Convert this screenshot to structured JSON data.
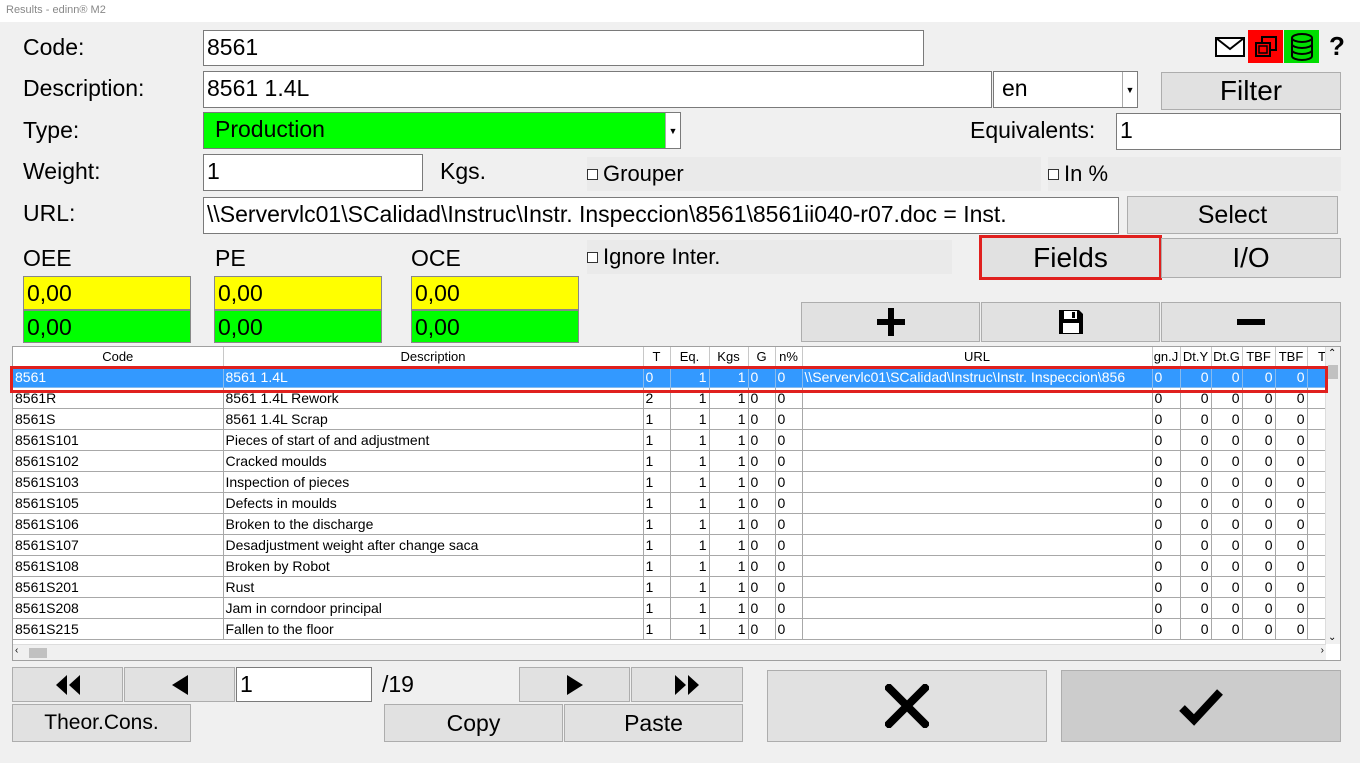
{
  "window": {
    "title": "Results - edinn® M2"
  },
  "form": {
    "code_label": "Code:",
    "code_value": "8561",
    "description_label": "Description:",
    "description_value": "8561 1.4L",
    "language_value": "en",
    "type_label": "Type:",
    "type_value": "Production",
    "weight_label": "Weight:",
    "weight_value": "1",
    "weight_unit": "Kgs.",
    "url_label": "URL:",
    "url_value": "\\\\Servervlc01\\SCalidad\\Instruc\\Instr. Inspeccion\\8561\\8561ii040-r07.doc = Inst.",
    "equivalents_label": "Equivalents:",
    "equivalents_value": "1",
    "grouper_label": "Grouper",
    "in_percent_label": "In %",
    "ignore_inter_label": "Ignore Inter."
  },
  "buttons": {
    "filter": "Filter",
    "select": "Select",
    "fields": "Fields",
    "io": "I/O",
    "theor_cons": "Theor.Cons.",
    "copy": "Copy",
    "paste": "Paste"
  },
  "ratios": {
    "oee_label": "OEE",
    "pe_label": "PE",
    "oce_label": "OCE",
    "oee_top": "0,00",
    "oee_bottom": "0,00",
    "pe_top": "0,00",
    "pe_bottom": "0,00",
    "oce_top": "0,00",
    "oce_bottom": "0,00"
  },
  "pagination": {
    "page": "1",
    "total": "/19"
  },
  "table": {
    "headers": [
      "Code",
      "Description",
      "T",
      "Eq.",
      "Kgs",
      "G",
      "n%",
      "URL",
      "gn.J",
      "Dt.Y",
      "Dt.G",
      "TBF",
      "TBF",
      "T"
    ],
    "rows": [
      [
        "8561",
        "8561 1.4L",
        "0",
        "1",
        "1",
        "0",
        "0",
        "\\\\Servervlc01\\SCalidad\\Instruc\\Instr. Inspeccion\\856",
        "0",
        "0",
        "0",
        "0",
        "0",
        ""
      ],
      [
        "8561R",
        "8561 1.4L Rework",
        "2",
        "1",
        "1",
        "0",
        "0",
        "",
        "0",
        "0",
        "0",
        "0",
        "0",
        ""
      ],
      [
        "8561S",
        "8561 1.4L Scrap",
        "1",
        "1",
        "1",
        "0",
        "0",
        "",
        "0",
        "0",
        "0",
        "0",
        "0",
        ""
      ],
      [
        "8561S101",
        "Pieces of start of and adjustment",
        "1",
        "1",
        "1",
        "0",
        "0",
        "",
        "0",
        "0",
        "0",
        "0",
        "0",
        ""
      ],
      [
        "8561S102",
        "Cracked moulds",
        "1",
        "1",
        "1",
        "0",
        "0",
        "",
        "0",
        "0",
        "0",
        "0",
        "0",
        ""
      ],
      [
        "8561S103",
        "Inspection of pieces",
        "1",
        "1",
        "1",
        "0",
        "0",
        "",
        "0",
        "0",
        "0",
        "0",
        "0",
        ""
      ],
      [
        "8561S105",
        "Defects in moulds",
        "1",
        "1",
        "1",
        "0",
        "0",
        "",
        "0",
        "0",
        "0",
        "0",
        "0",
        ""
      ],
      [
        "8561S106",
        "Broken to the discharge",
        "1",
        "1",
        "1",
        "0",
        "0",
        "",
        "0",
        "0",
        "0",
        "0",
        "0",
        ""
      ],
      [
        "8561S107",
        "Desadjustment weight after change saca",
        "1",
        "1",
        "1",
        "0",
        "0",
        "",
        "0",
        "0",
        "0",
        "0",
        "0",
        ""
      ],
      [
        "8561S108",
        "Broken by Robot",
        "1",
        "1",
        "1",
        "0",
        "0",
        "",
        "0",
        "0",
        "0",
        "0",
        "0",
        ""
      ],
      [
        "8561S201",
        "Rust",
        "1",
        "1",
        "1",
        "0",
        "0",
        "",
        "0",
        "0",
        "0",
        "0",
        "0",
        ""
      ],
      [
        "8561S208",
        "Jam in corndoor principal",
        "1",
        "1",
        "1",
        "0",
        "0",
        "",
        "0",
        "0",
        "0",
        "0",
        "0",
        ""
      ],
      [
        "8561S215",
        "Fallen to the floor",
        "1",
        "1",
        "1",
        "0",
        "0",
        "",
        "0",
        "0",
        "0",
        "0",
        "0",
        ""
      ]
    ]
  },
  "icons": {
    "mail": "mail-icon",
    "windows": "windows-icon",
    "database": "database-icon",
    "help": "help-icon"
  },
  "colors": {
    "selected_row": "#3399ff",
    "highlight": "#e0201e",
    "green": "#00ff00",
    "yellow": "#ffff00"
  }
}
